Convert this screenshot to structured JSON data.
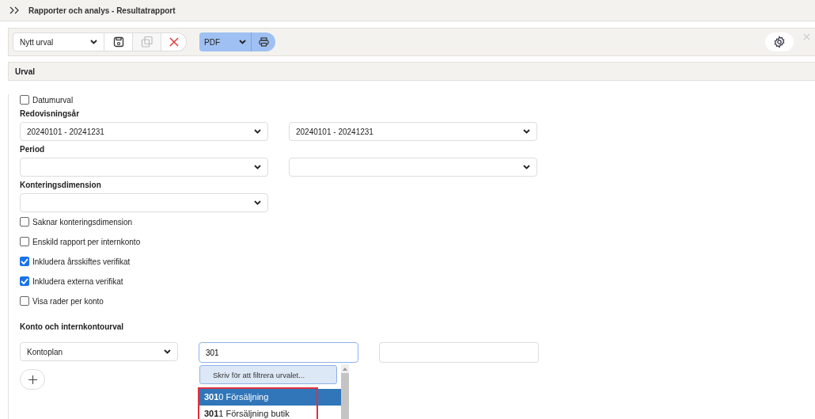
{
  "header": {
    "title": "Rapporter och analys - Resultatrapport"
  },
  "toolbar": {
    "selection": {
      "value": "Nytt urval"
    },
    "format": {
      "value": "PDF"
    }
  },
  "section": {
    "title": "Urval"
  },
  "datumurval": {
    "label": "Datumurval",
    "checked": false
  },
  "fields": [
    {
      "label": "Redovisningsår",
      "selects": [
        {
          "kind": "value",
          "value": "20240101 - 20241231"
        },
        {
          "kind": "value",
          "value": "20240101 - 20241231"
        }
      ]
    },
    {
      "label": "Period",
      "selects": [
        {
          "kind": "empty"
        },
        {
          "kind": "empty"
        }
      ]
    },
    {
      "label": "Konteringsdimension",
      "selects": [
        {
          "kind": "empty"
        }
      ]
    }
  ],
  "checkboxes": [
    {
      "label": "Saknar konteringsdimension",
      "checked": false
    },
    {
      "label": "Enskild rapport per internkonto",
      "checked": false
    },
    {
      "label": "Inkludera årsskiftes verifikat",
      "checked": true
    },
    {
      "label": "Inkludera externa verifikat",
      "checked": true
    },
    {
      "label": "Visa rader per konto",
      "checked": false
    }
  ],
  "account": {
    "title": "Konto och internkontourval",
    "plan": {
      "value": "Kontoplan"
    },
    "search": {
      "value": "301"
    },
    "dropdown": {
      "filter_placeholder": "Skriv för att filtrera urvalet...",
      "options": [
        {
          "label": "**301**0 Försäljning",
          "selected": true
        },
        {
          "label": "**301**1 Försäljning butik",
          "selected": false
        }
      ]
    }
  }
}
